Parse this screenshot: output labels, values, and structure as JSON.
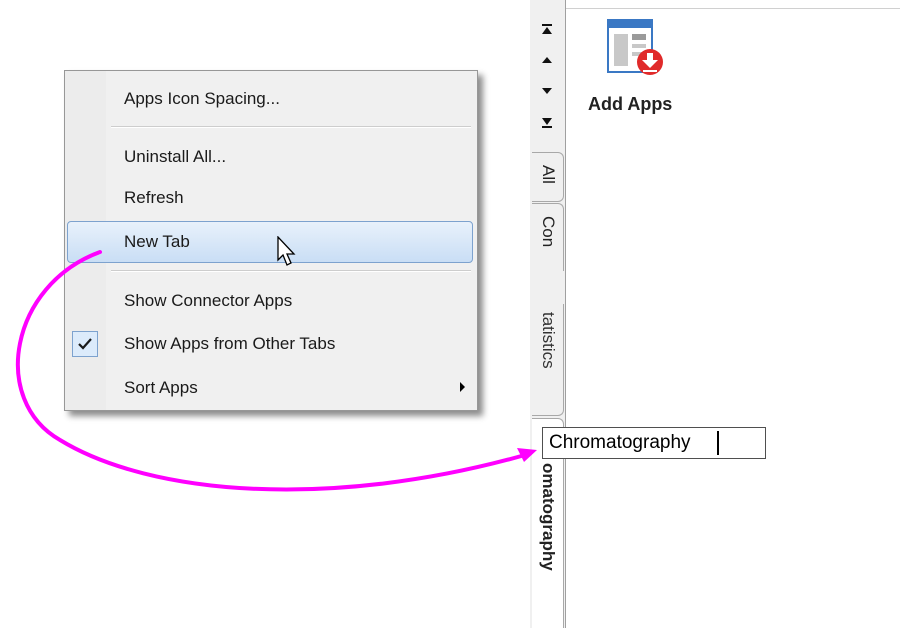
{
  "context_menu": {
    "items": [
      {
        "label": "Apps Icon Spacing..."
      },
      {
        "label": "Uninstall All..."
      },
      {
        "label": "Refresh"
      },
      {
        "label": "New Tab",
        "state": "hovered"
      },
      {
        "label": "Show Connector Apps"
      },
      {
        "label": "Show Apps from Other Tabs",
        "checked": true,
        "icon": "checkmark-icon"
      },
      {
        "label": "Sort Apps",
        "has_submenu": true,
        "icon": "submenu-arrow-icon"
      }
    ]
  },
  "tab_strip": {
    "nav_icons": [
      "first-tab-icon",
      "previous-tab-icon",
      "next-tab-icon",
      "last-tab-icon"
    ],
    "tabs": [
      {
        "label": "All"
      },
      {
        "label": "Con"
      },
      {
        "label": "tatistics"
      },
      {
        "label": "omatography",
        "active": true
      }
    ]
  },
  "apps_panel": {
    "apps": [
      {
        "label": "Add Apps",
        "icon": "add-apps-icon"
      }
    ]
  },
  "rename_field": {
    "value": "Chromatography"
  },
  "annotation": {
    "arrow_color": "#ff00ff"
  }
}
